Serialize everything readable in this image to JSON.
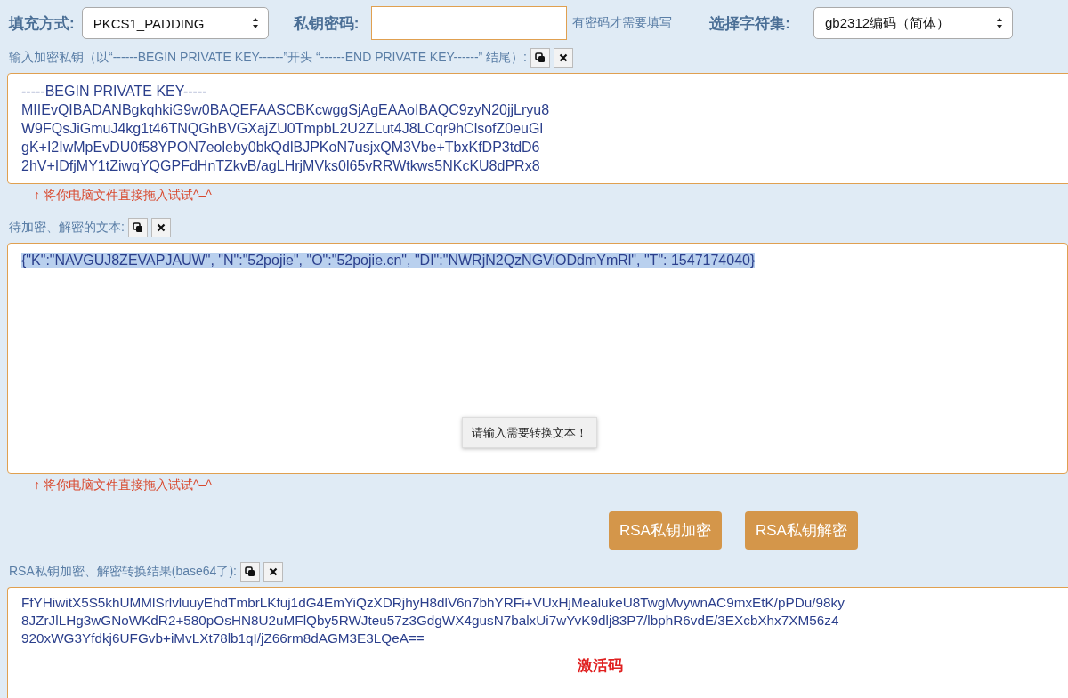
{
  "options": {
    "padding": {
      "label": "填充方式:",
      "value": "PKCS1_PADDING"
    },
    "password": {
      "label": "私钥密码:",
      "hint": "有密码才需要填写"
    },
    "charset": {
      "label": "选择字符集:",
      "value": "gb2312编码（简体）"
    }
  },
  "key_section": {
    "label": "输入加密私钥（以“------BEGIN PRIVATE KEY------”开头 “------END PRIVATE KEY------” 结尾）:",
    "lines": [
      "-----BEGIN PRIVATE KEY-----",
      "MIIEvQIBADANBgkqhkiG9w0BAQEFAASCBKcwggSjAgEAAoIBAQC9zyN20jjLryu8",
      "W9FQsJiGmuJ4kg1t46TNQGhBVGXajZU0TmpbL2U2ZLut4J8LCqr9hClsofZ0euGl",
      "gK+I2IwMpEvDU0f58YPON7eoleby0bkQdlBJPKoN7usjxQM3Vbe+TbxKfDP3tdD6",
      "2hV+IDfjMY1tZiwqYQGPFdHnTZkvB/agLHrjMVks0l65vRRWtkws5NKcKU8dPRx8"
    ],
    "hint": "↑ 将你电脑文件直接拖入试试^–^"
  },
  "text_section": {
    "label": "待加密、解密的文本:",
    "text": "{\"K\":\"NAVGUJ8ZEVAPJAUW\", \"N\":\"52pojie\", \"O\":\"52pojie.cn\", \"DI\":\"NWRjN2QzNGViODdmYmRl\", \"T\": 1547174040}",
    "selected": true,
    "tooltip": "请输入需要转换文本！",
    "hint": "↑ 将你电脑文件直接拖入试试^–^"
  },
  "buttons": [
    "RSA私钥加密",
    "RSA私钥解密"
  ],
  "result_section": {
    "label": "RSA私钥加密、解密转换结果(base64了):",
    "lines": [
      "FfYHiwitX5S5khUMMlSrlvluuyEhdTmbrLKfuj1dG4EmYiQzXDRjhyH8dlV6n7bhYRFi+VUxHjMealukeU8TwgMvywnAC9mxEtK/pPDu/98ky",
      "8JZrJlLHg3wGNoWKdR2+580pOsHN8U2uMFlQby5RWJteu57z3GdgWX4gusN7balxUi7wYvK9dlj83P7/lbphR6vdE/3EXcbXhx7XM56z4",
      "920xWG3Yfdkj6UFGvb+iMvLXt78lb1qI/jZ66rm8dAGM3E3LQeA=="
    ],
    "annotation": "激活码"
  }
}
